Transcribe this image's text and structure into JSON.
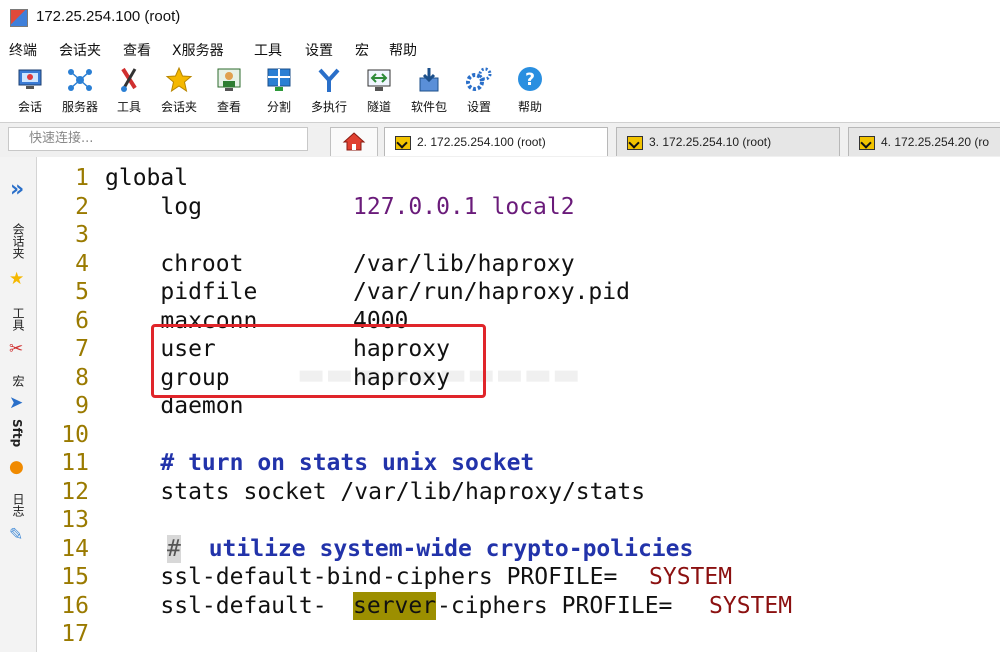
{
  "window": {
    "title": "172.25.254.100 (root)"
  },
  "menu": [
    "终端",
    "会话夹",
    "查看",
    "X服务器",
    "工具",
    "设置",
    "宏",
    "帮助"
  ],
  "toolbar": [
    {
      "label": "会话",
      "icon": "session-icon"
    },
    {
      "label": "服务器",
      "icon": "servers-icon"
    },
    {
      "label": "工具",
      "icon": "tools-icon"
    },
    {
      "label": "会话夹",
      "icon": "star-icon"
    },
    {
      "label": "查看",
      "icon": "view-icon"
    },
    {
      "label": "分割",
      "icon": "split-icon"
    },
    {
      "label": "多执行",
      "icon": "multiexec-icon"
    },
    {
      "label": "隧道",
      "icon": "tunnel-icon"
    },
    {
      "label": "软件包",
      "icon": "packages-icon"
    },
    {
      "label": "设置",
      "icon": "settings-icon"
    },
    {
      "label": "帮助",
      "icon": "help-icon"
    }
  ],
  "quick_connect": {
    "placeholder": "快速连接..."
  },
  "tabs": [
    {
      "label": "2. 172.25.254.100 (root)",
      "active": true
    },
    {
      "label": "3. 172.25.254.10 (root)",
      "active": false
    },
    {
      "label": "4. 172.25.254.20 (ro",
      "active": false
    }
  ],
  "sidebar": {
    "sessions": "会话夹",
    "tools": "工具",
    "macros": "宏",
    "sftp": "Sftp",
    "logs": "日志"
  },
  "terminal": {
    "lines": [
      {
        "n": "1",
        "key": "global",
        "val": ""
      },
      {
        "n": "2",
        "key": "    log",
        "val": "127.0.0.1 local2"
      },
      {
        "n": "3",
        "key": "",
        "val": ""
      },
      {
        "n": "4",
        "key": "    chroot",
        "val": "/var/lib/haproxy"
      },
      {
        "n": "5",
        "key": "    pidfile",
        "val": "/var/run/haproxy.pid"
      },
      {
        "n": "6",
        "key": "    maxconn",
        "val": "4000"
      },
      {
        "n": "7",
        "key": "    user",
        "val": "haproxy"
      },
      {
        "n": "8",
        "key": "    group",
        "val": "haproxy"
      },
      {
        "n": "9",
        "key": "    daemon",
        "val": ""
      },
      {
        "n": "10",
        "key": "",
        "val": ""
      },
      {
        "n": "11",
        "key": "    # turn on stats unix socket",
        "val": ""
      },
      {
        "n": "12",
        "key": "    stats socket /var/lib/haproxy/stats",
        "val": ""
      },
      {
        "n": "13",
        "key": "",
        "val": ""
      },
      {
        "n": "14",
        "hash": "#",
        "rest": "  utilize system-wide crypto-policies"
      },
      {
        "n": "15",
        "pre": "    ssl-default-bind-ciphers PROFILE=",
        "red": "SYSTEM"
      },
      {
        "n": "16",
        "pre": "    ssl-default-",
        "hl": "server",
        "mid": "-ciphers PROFILE=",
        "red": "SYSTEM"
      },
      {
        "n": "17",
        "key": "",
        "val": ""
      }
    ]
  },
  "colors": {
    "highlight_box": "#e0252a",
    "value_purple": "#6a1b7a",
    "comment_blue": "#2233aa",
    "line_number": "#9a7a00"
  }
}
